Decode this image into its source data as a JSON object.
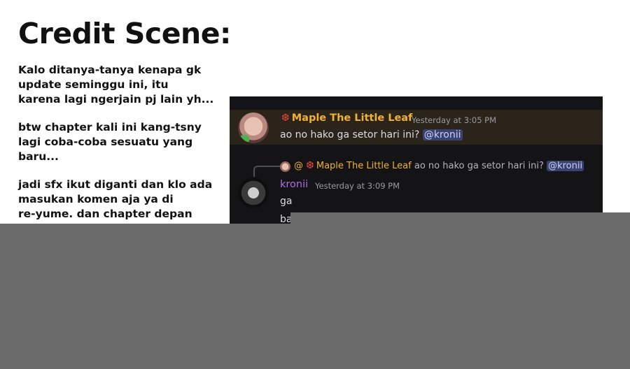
{
  "title": "Credit Scene:",
  "notes": [
    [
      "Kalo ditanya-tanya kenapa gk",
      "update seminggu ini, itu",
      "karena lagi ngerjain pj lain yh..."
    ],
    [
      "btw chapter kali ini kang-tsny",
      "lagi coba-coba sesuatu yang",
      "baru..."
    ],
    [
      "jadi sfx ikut diganti dan klo ada",
      "masukan komen aja ya di",
      "re-yume. dan chapter depan"
    ]
  ],
  "chat": {
    "msg1": {
      "username": "Maple The Little Leaf",
      "timestamp": "Yesterday at 3:05 PM",
      "text": "ao no hako ga setor hari ini?",
      "mention": "@kronii"
    },
    "reply": {
      "at": "@",
      "username": "Maple The Little Leaf",
      "text": "ao no hako ga setor hari ini?",
      "mention": "@kronii"
    },
    "msg2": {
      "username": "kronii",
      "timestamp": "Yesterday at 3:09 PM",
      "line1": "ga",
      "line2": "ba"
    }
  },
  "colors": {
    "maple_name": "#f0b232",
    "kronii_name": "#b06ee8",
    "chat_bg": "#141417",
    "highlight_bg": "#2a241a",
    "cover_gray": "#6b6b6b"
  },
  "icons": [
    "maple-leaf-icon",
    "avatar",
    "reply-connector-icon"
  ]
}
